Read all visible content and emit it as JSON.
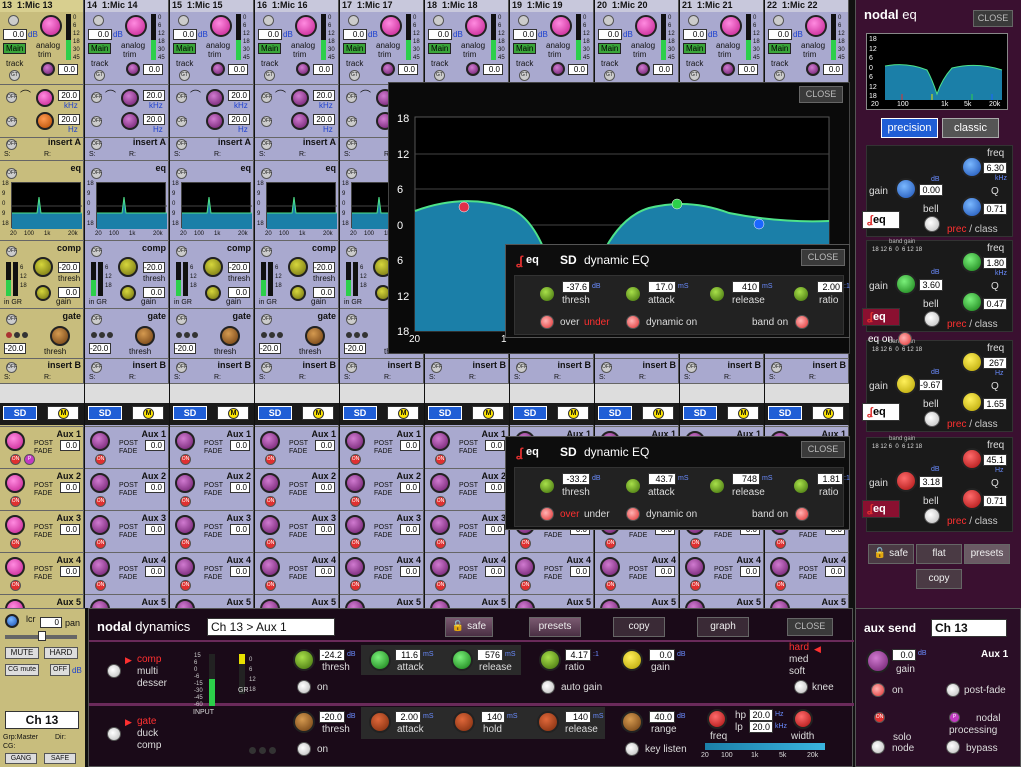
{
  "channels": [
    {
      "num": "13",
      "name": "1:Mic 13",
      "selected": true
    },
    {
      "num": "14",
      "name": "1:Mic 14",
      "selected": false
    },
    {
      "num": "15",
      "name": "1:Mic 15",
      "selected": false
    },
    {
      "num": "16",
      "name": "1:Mic 16",
      "selected": false
    },
    {
      "num": "17",
      "name": "1:Mic 17",
      "selected": false
    },
    {
      "num": "18",
      "name": "1:Mic 18",
      "selected": false
    },
    {
      "num": "19",
      "name": "1:Mic 19",
      "selected": false
    },
    {
      "num": "20",
      "name": "1:Mic 20",
      "selected": false
    },
    {
      "num": "21",
      "name": "1:Mic 21",
      "selected": false
    },
    {
      "num": "22",
      "name": "1:Mic 22",
      "selected": false
    }
  ],
  "strip": {
    "gain_value": "0.0",
    "gain_unit": "dB",
    "main_label": "Main",
    "analog": "analog",
    "trim": "trim",
    "track": "track",
    "gt": "GT",
    "trim_value": "0.0",
    "off": "OFF",
    "on": "ON",
    "hpf_freq": "20.0",
    "hpf_unit": "kHz",
    "lpf_freq": "20.0",
    "lpf_unit": "Hz",
    "insert_a": "insert A",
    "insert_b": "insert B",
    "eq": "eq",
    "comp": "comp",
    "gate": "gate",
    "thresh": "thresh",
    "gain": "gain",
    "in_gr": "in GR",
    "comp_thresh": "-20.0",
    "comp_gain": "0.0",
    "gate_thresh": "-20.0",
    "s": "S:",
    "r": "R:",
    "sd": "SD",
    "m": "M",
    "post": "POST",
    "fade": "FADE",
    "aux_value": "0.0",
    "meter_ticks": [
      "0",
      "6",
      "12",
      "18",
      "30",
      "45"
    ],
    "eq_ticks": [
      "18",
      "9",
      "0",
      "9",
      "18"
    ],
    "eq_freqs": [
      "20",
      "100",
      "1k",
      "20k"
    ],
    "aux_labels": [
      "Aux 1",
      "Aux 2",
      "Aux 3",
      "Aux 4",
      "Aux 5"
    ],
    "p": "P",
    "comp_ticks": [
      "6",
      "12",
      "18"
    ]
  },
  "left_bottom": {
    "lcr": "lcr",
    "pan": "pan",
    "pan_value": "0",
    "mute": "MUTE",
    "hard": "HARD",
    "cg_mute": "CG mute",
    "off": "OFF",
    "db": "dB",
    "channel": "Ch 13",
    "grp": "Grp:Master",
    "dir": "Dir:",
    "cg": "CG:",
    "gang": "GANG",
    "safe": "SAFE"
  },
  "eq_graph": {
    "close": "CLOSE",
    "y_ticks": [
      "18",
      "12",
      "6",
      "0",
      "6",
      "12",
      "18"
    ],
    "x_first": "20",
    "x_next": "1"
  },
  "dyn_eq_1": {
    "brand": "eq",
    "sd": "SD",
    "title": "dynamic EQ",
    "close": "CLOSE",
    "thresh": "-37.6",
    "thresh_unit": "dB",
    "thresh_lbl": "thresh",
    "attack": "17.0",
    "attack_unit": "mS",
    "attack_lbl": "attack",
    "release": "410",
    "release_unit": "mS",
    "release_lbl": "release",
    "ratio": "2.00",
    "ratio_unit": ":1",
    "ratio_lbl": "ratio",
    "over": "over",
    "under": "under",
    "dynamic_on": "dynamic on",
    "band_on": "band on",
    "active": "under"
  },
  "dyn_eq_2": {
    "brand": "eq",
    "sd": "SD",
    "title": "dynamic EQ",
    "close": "CLOSE",
    "thresh": "-33.2",
    "thresh_unit": "dB",
    "thresh_lbl": "thresh",
    "attack": "43.7",
    "attack_unit": "mS",
    "attack_lbl": "attack",
    "release": "748",
    "release_unit": "mS",
    "release_lbl": "release",
    "ratio": "1.81",
    "ratio_unit": ":1",
    "ratio_lbl": "ratio",
    "over": "over",
    "under": "under",
    "dynamic_on": "dynamic on",
    "band_on": "band on",
    "active": "over"
  },
  "nodal_eq": {
    "title_nodal": "nodal",
    "title_eq": "eq",
    "close": "CLOSE",
    "precision": "precision",
    "classic": "classic",
    "graph_y": [
      "18",
      "12",
      "6",
      "0",
      "6",
      "12",
      "18"
    ],
    "graph_x": [
      "20",
      "100",
      "1k",
      "5k",
      "20k"
    ],
    "bands": [
      {
        "gain": "0.00",
        "freq": "6.30",
        "freq_unit": "kHz",
        "q": "0.71",
        "color": "blue",
        "shape": "bell"
      },
      {
        "gain": "3.60",
        "freq": "1.80",
        "freq_unit": "kHz",
        "q": "0.47",
        "color": "green",
        "shape": "bell"
      },
      {
        "gain": "-9.67",
        "freq": "267",
        "freq_unit": "Hz",
        "q": "1.65",
        "color": "yellow",
        "shape": "bell"
      },
      {
        "gain": "3.18",
        "freq": "45.1",
        "freq_unit": "Hz",
        "q": "0.71",
        "color": "red",
        "shape": "bell"
      }
    ],
    "gain_lbl": "gain",
    "db": "dB",
    "freq_lbl": "freq",
    "q_lbl": "Q",
    "prec": "prec",
    "class": "class",
    "band_gain": "band gain",
    "band_gain_ticks": "18 12 6  0  6 12 18",
    "eq_on": "eq on",
    "eq_badge": "eq",
    "safe": "safe",
    "flat": "flat",
    "presets": "presets",
    "copy": "copy"
  },
  "dynamics": {
    "title_nodal": "nodal",
    "title_dyn": "dynamics",
    "target": "Ch 13 > Aux 1",
    "safe": "safe",
    "presets": "presets",
    "copy": "copy",
    "graph": "graph",
    "close": "CLOSE",
    "comp": "comp",
    "multi": "multi",
    "desser": "desser",
    "gate": "gate",
    "duck": "duck",
    "comp2": "comp",
    "input": "INPUT",
    "gr": "GR",
    "input_ticks": [
      "15",
      "6",
      "0",
      "-6",
      "-15",
      "-30",
      "-45",
      "-60"
    ],
    "gr_ticks": [
      "0",
      "6",
      "12",
      "18"
    ],
    "c_thresh": "-24.2",
    "c_attack": "11.6",
    "c_release": "576",
    "c_ratio": "4.17",
    "c_gain": "0.0",
    "g_thresh": "-20.0",
    "g_attack": "2.00",
    "g_hold": "140",
    "g_release": "140",
    "g_range": "40.0",
    "hp": "20.0",
    "lp": "20.0",
    "thresh": "thresh",
    "attack": "attack",
    "release": "release",
    "ratio": "ratio",
    "gain": "gain",
    "hold": "hold",
    "range": "range",
    "freq": "freq",
    "width": "width",
    "on": "on",
    "auto_gain": "auto gain",
    "knee": "knee",
    "hard": "hard",
    "med": "med",
    "soft": "soft",
    "key_listen": "key listen",
    "db": "dB",
    "ms": "mS",
    "ratio_unit": ":1",
    "hz": "Hz",
    "khz": "kHz",
    "hp_lbl": "hp",
    "lp_lbl": "lp",
    "scale": [
      "20",
      "100",
      "1k",
      "5k",
      "20k"
    ]
  },
  "aux_send": {
    "title": "aux send",
    "channel": "Ch 13",
    "aux": "Aux 1",
    "gain": "gain",
    "value": "0.0",
    "db": "dB",
    "on": "on",
    "post_fade": "post-fade",
    "on_badge": "ON",
    "p_badge": "P",
    "solo": "solo",
    "node": "node",
    "nodal": "nodal",
    "processing": "processing",
    "bypass": "bypass"
  }
}
